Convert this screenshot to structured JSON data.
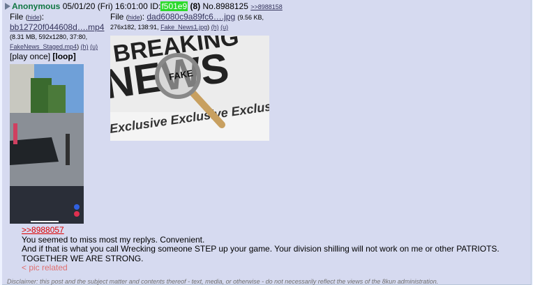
{
  "post": {
    "name": "Anonymous",
    "datetime": "05/01/20 (Fri) 16:01:00",
    "id_label": "ID:",
    "id": "f501e9",
    "id_count": "(8)",
    "post_no": "No.8988125",
    "backlink": ">>8988158"
  },
  "files": [
    {
      "label": "File",
      "hide": "hide",
      "name": "bb12720f044608d….mp4",
      "meta_prefix": "(8.31 MB, 592x1280, 37:80,",
      "original": "FakeNews_Staged.mp4",
      "h": "(h)",
      "u": "(u)",
      "play_once": "[play once]",
      "loop": "[loop]"
    },
    {
      "label": "File",
      "hide": "hide",
      "name": "dad6080c9a89fc6….jpg",
      "meta_size": "(9.56 KB,",
      "meta_prefix": "276x182, 138:91,",
      "original": "Fake_News1.jpg",
      "h": "(h)",
      "u": "(u)",
      "newspaper_text_1": "BREAKING",
      "newspaper_text_2": "NEWS",
      "newspaper_text_3": "Exclusive Exclusive Exclusive",
      "magnifier_text": "FAKE"
    }
  ],
  "body": {
    "quote": ">>8988057",
    "line1": "You seemed to miss most my replys. Convenient.",
    "line2": "And if that is what you call Wrecking someone STEP up your game. Your division shilling will not work on me or other PATRIOTS.",
    "line3": "TOGETHER WE ARE STRONG.",
    "greentext": "< pic related"
  },
  "disclaimer": "Disclaimer: this post and the subject matter and contents thereof - text, media, or otherwise - do not necessarily reflect the views of the 8kun administration.",
  "colors": {
    "name": "#117743",
    "id_bg": "#2bd92b",
    "post_bg": "#d6daf0",
    "quote": "#dd0000",
    "greentext": "#e07070"
  }
}
